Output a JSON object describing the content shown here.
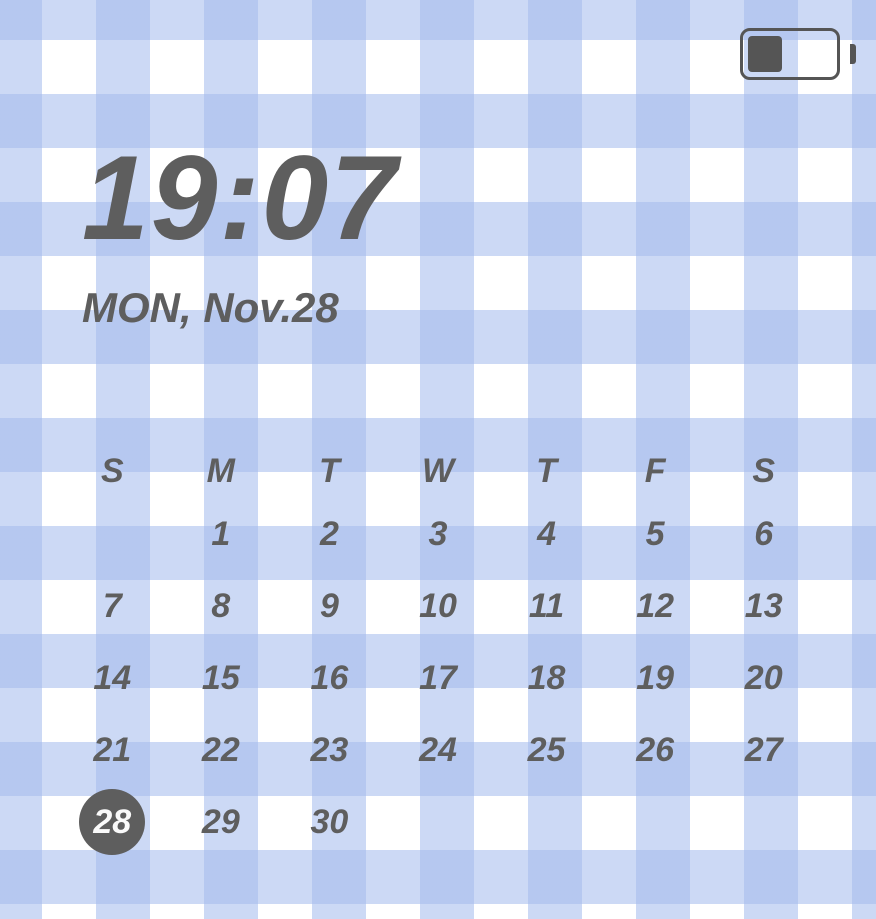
{
  "battery": {
    "level_percent": 40
  },
  "clock": {
    "time": "19:07",
    "date": "MON, Nov.28"
  },
  "calendar": {
    "weekdays": [
      "S",
      "M",
      "T",
      "W",
      "T",
      "F",
      "S"
    ],
    "first_day_column": 2,
    "days_in_month": 30,
    "today": 28
  }
}
